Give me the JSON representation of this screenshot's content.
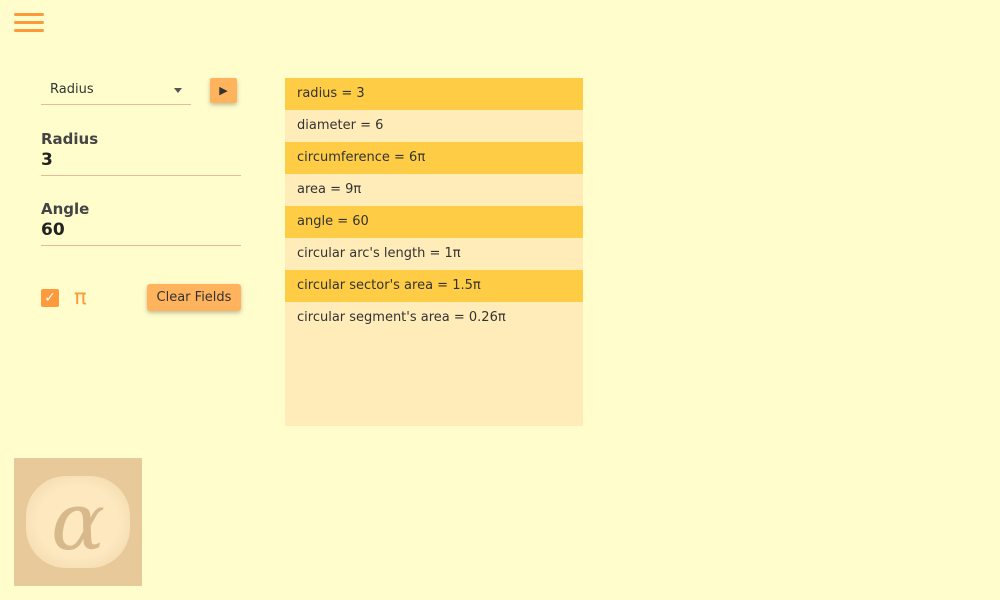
{
  "menu_icon": "hamburger-icon",
  "mode_select": {
    "value": "Radius"
  },
  "play_button": {
    "label": "▶"
  },
  "fields": [
    {
      "label": "Radius",
      "value": "3"
    },
    {
      "label": "Angle",
      "value": "60"
    }
  ],
  "pi_checkbox": {
    "checked": true,
    "label": "π"
  },
  "clear_button": {
    "label": "Clear Fields"
  },
  "results": [
    "radius = 3",
    "diameter = 6",
    "circumference = 6π",
    "area = 9π",
    "angle = 60",
    "circular arc's length = 1π",
    "circular sector's area = 1.5π",
    "circular segment's area = 0.26π"
  ],
  "logo": {
    "glyph": "α"
  },
  "colors": {
    "background": "#fffdcc",
    "accent": "#ff9a3c",
    "highlight": "#ffcd45"
  }
}
